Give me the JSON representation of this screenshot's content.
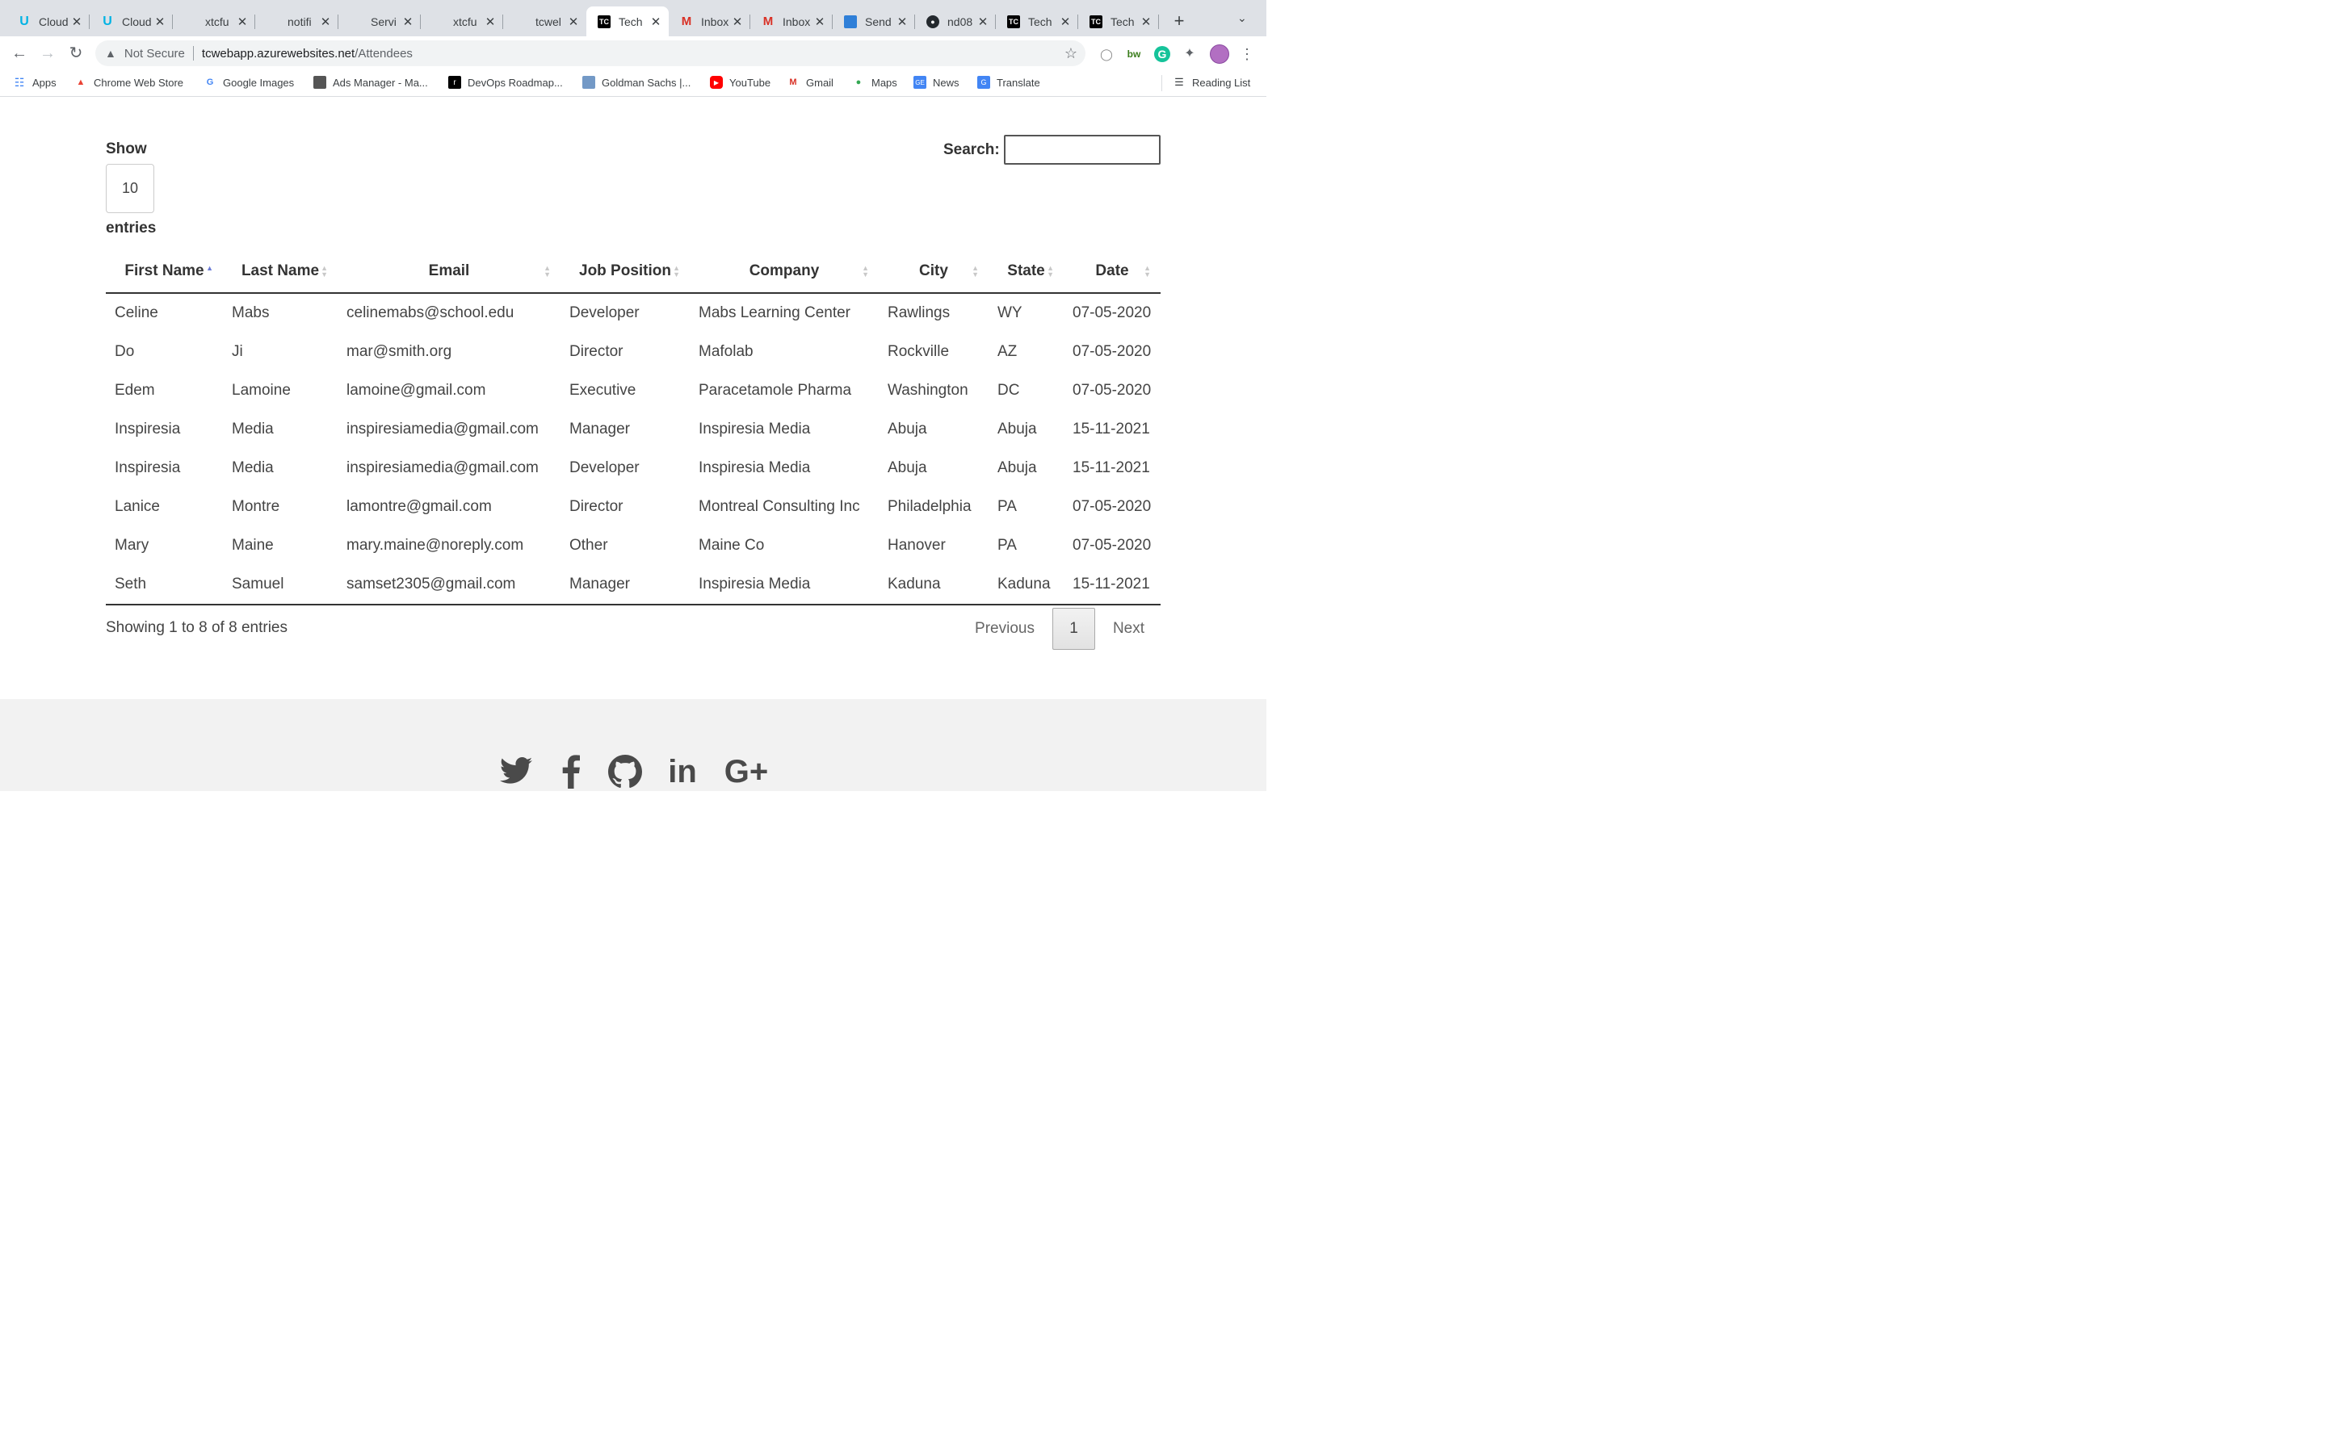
{
  "browser": {
    "tabs": [
      {
        "title": "Cloud",
        "icon": "udacity-icon"
      },
      {
        "title": "Cloud",
        "icon": "udacity-icon"
      },
      {
        "title": "xtcfu",
        "icon": "microsoft-icon"
      },
      {
        "title": "notifi",
        "icon": "microsoft-icon"
      },
      {
        "title": "Servi",
        "icon": "microsoft-icon"
      },
      {
        "title": "xtcfu",
        "icon": "microsoft-icon"
      },
      {
        "title": "tcwel",
        "icon": "microsoft-icon"
      },
      {
        "title": "Tech",
        "icon": "techconf-icon",
        "active": true
      },
      {
        "title": "Inbox",
        "icon": "gmail-icon"
      },
      {
        "title": "Inbox",
        "icon": "gmail-icon"
      },
      {
        "title": "Send",
        "icon": "sendgrid-icon"
      },
      {
        "title": "nd08",
        "icon": "github-icon"
      },
      {
        "title": "Tech",
        "icon": "techconf-icon"
      },
      {
        "title": "Tech",
        "icon": "techconf-icon"
      }
    ],
    "address": {
      "security": "Not Secure",
      "host": "tcwebapp.azurewebsites.net",
      "path": "/Attendees"
    },
    "bookmarks": {
      "apps": "Apps",
      "chrome_web_store": "Chrome Web Store",
      "google_images": "Google Images",
      "ads_manager": "Ads Manager - Ma...",
      "devops_roadmap": "DevOps Roadmap...",
      "goldman_sachs": "Goldman Sachs |...",
      "youtube": "YouTube",
      "gmail": "Gmail",
      "maps": "Maps",
      "news": "News",
      "translate": "Translate",
      "reading_list": "Reading List"
    }
  },
  "attendees": {
    "length": {
      "show_label": "Show",
      "value": "10",
      "entries_label": "entries"
    },
    "search": {
      "label": "Search:",
      "value": ""
    },
    "columns": [
      "First Name",
      "Last Name",
      "Email",
      "Job Position",
      "Company",
      "City",
      "State",
      "Date"
    ],
    "sorted_column": "First Name",
    "rows": [
      [
        "Celine",
        "Mabs",
        "celinemabs@school.edu",
        "Developer",
        "Mabs Learning Center",
        "Rawlings",
        "WY",
        "07-05-2020"
      ],
      [
        "Do",
        "Ji",
        "mar@smith.org",
        "Director",
        "Mafolab",
        "Rockville",
        "AZ",
        "07-05-2020"
      ],
      [
        "Edem",
        "Lamoine",
        "lamoine@gmail.com",
        "Executive",
        "Paracetamole Pharma",
        "Washington",
        "DC",
        "07-05-2020"
      ],
      [
        "Inspiresia",
        "Media",
        "inspiresiamedia@gmail.com",
        "Manager",
        "Inspiresia Media",
        "Abuja",
        "Abuja",
        "15-11-2021"
      ],
      [
        "Inspiresia",
        "Media",
        "inspiresiamedia@gmail.com",
        "Developer",
        "Inspiresia Media",
        "Abuja",
        "Abuja",
        "15-11-2021"
      ],
      [
        "Lanice",
        "Montre",
        "lamontre@gmail.com",
        "Director",
        "Montreal Consulting Inc",
        "Philadelphia",
        "PA",
        "07-05-2020"
      ],
      [
        "Mary",
        "Maine",
        "mary.maine@noreply.com",
        "Other",
        "Maine Co",
        "Hanover",
        "PA",
        "07-05-2020"
      ],
      [
        "Seth",
        "Samuel",
        "samset2305@gmail.com",
        "Manager",
        "Inspiresia Media",
        "Kaduna",
        "Kaduna",
        "15-11-2021"
      ]
    ],
    "info": "Showing 1 to 8 of 8 entries",
    "pagination": {
      "previous": "Previous",
      "current": "1",
      "next": "Next"
    }
  },
  "footer": {
    "social_icons": [
      "twitter-icon",
      "facebook-icon",
      "github-icon",
      "linkedin-icon",
      "google-plus-icon"
    ],
    "google_plus_text": "G+",
    "linkedin_text": "in"
  },
  "colors": {
    "sort_active": "#6b7bd6",
    "tab_strip": "#dee1e6",
    "footer_bg": "#f2f2f2"
  }
}
